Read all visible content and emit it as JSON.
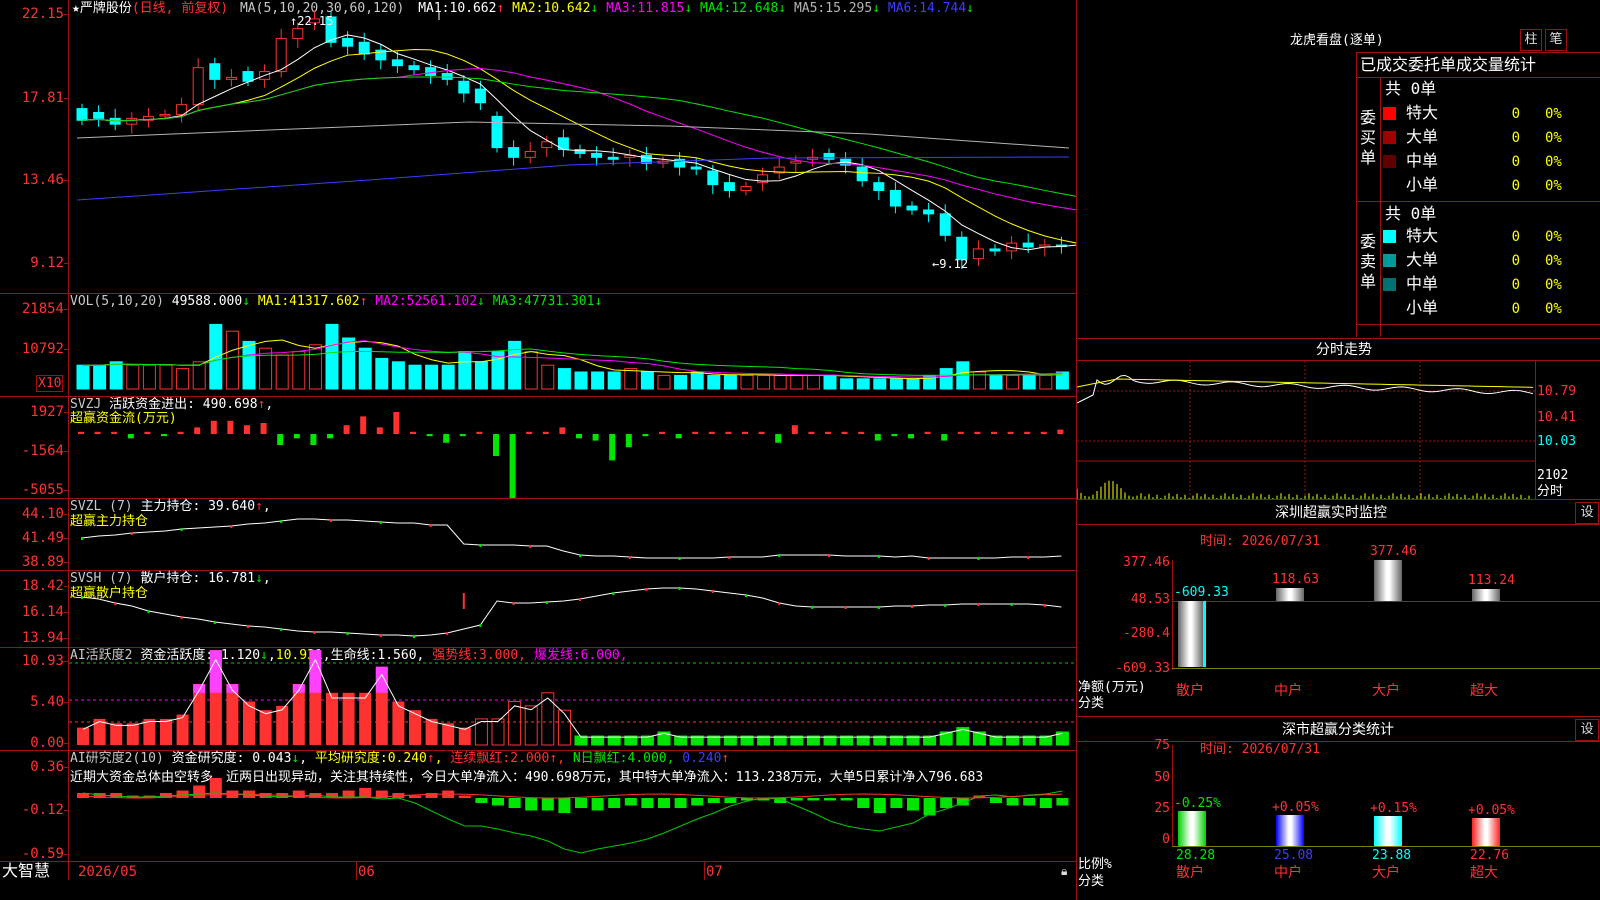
{
  "colors": {
    "up": "#ff3232",
    "down": "#00ffff",
    "ma1": "#ffffff",
    "ma2": "#ffff00",
    "ma3": "#ff00ff",
    "ma4": "#00e600",
    "ma5": "#b4b4b4",
    "ma6": "#3c3cff",
    "border": "#a01010"
  },
  "main": {
    "star": "★",
    "name": "严牌股份",
    "mode": "(日线, 前复权)",
    "ma_label": "MA(5,10,20,30,60,120)",
    "ma": [
      {
        "label": "MA1:",
        "value": "10.662",
        "arrow": "↑",
        "color": "#ffffff"
      },
      {
        "label": "MA2:",
        "value": "10.642",
        "arrow": "↓",
        "color": "#ffff00"
      },
      {
        "label": "MA3:",
        "value": "11.815",
        "arrow": "↓",
        "color": "#ff00ff"
      },
      {
        "label": "MA4:",
        "value": "12.648",
        "arrow": "↓",
        "color": "#00e600"
      },
      {
        "label": "MA5:",
        "value": "15.295",
        "arrow": "↓",
        "color": "#b4b4b4"
      },
      {
        "label": "MA6:",
        "value": "14.744",
        "arrow": "↓",
        "color": "#3c3cff"
      }
    ],
    "y_ticks": [
      "22.15",
      "17.81",
      "13.46",
      "9.12"
    ],
    "high_note": "22.15",
    "low_note": "9.12",
    "x_labels": [
      "2026/05",
      "06",
      "07"
    ]
  },
  "vol": {
    "label": "VOL(5,10,20)",
    "value": "49588.000",
    "arrow": "↓",
    "ma": [
      {
        "label": "MA1:",
        "value": "41317.602",
        "arrow": "↑",
        "color": "#ffff00"
      },
      {
        "label": "MA2:",
        "value": "52561.102",
        "arrow": "↓",
        "color": "#ff00ff"
      },
      {
        "label": "MA3:",
        "value": "47731.301",
        "arrow": "↓",
        "color": "#00e600"
      }
    ],
    "y_ticks": [
      "21854",
      "10792"
    ],
    "unit": "X10"
  },
  "svzj": {
    "label": "SVZJ",
    "title": "活跃资金进出:",
    "value": "490.698",
    "arrow": "↑",
    "comma": ",",
    "sub": "超赢资金流(万元)",
    "y_ticks": [
      "1927",
      "-1564",
      "-5055"
    ]
  },
  "svzl": {
    "label": "SVZL (7)",
    "title": "主力持仓:",
    "value": "39.640",
    "arrow": "↑",
    "comma": ",",
    "sub": "超赢主力持仓",
    "y_ticks": [
      "44.10",
      "41.49",
      "38.89"
    ]
  },
  "svsh": {
    "label": "SVSH (7)",
    "title": "散户持仓:",
    "value": "16.781",
    "arrow": "↓",
    "comma": ",",
    "sub": "超赢散户持仓",
    "y_ticks": [
      "18.42",
      "16.14",
      "13.94"
    ]
  },
  "ai1": {
    "label": "AI活跃度2",
    "t1": "资金活跃度:",
    "v1": "1.120",
    "a1": "↓",
    "c1": ",",
    "v2": "10.931",
    "c2": ",",
    "t3": "生命线:",
    "v3": "1.560",
    "c3": ",",
    "t4": "强势线:",
    "v4": "3.000",
    "c4": ",",
    "t5": "爆发线:",
    "v5": "6.000",
    "c5": ",",
    "y_ticks": [
      "10.93",
      "5.40",
      "0.00"
    ]
  },
  "ai2": {
    "label": "AI研究度2(10)",
    "t1": "资金研究度:",
    "v1": "0.043",
    "a1": "↓",
    "c1": ",",
    "t2": "平均研究度:",
    "v2": "0.240",
    "a2": "↑",
    "c2": ",",
    "t3": "连续飘红:",
    "v3": "2.000",
    "a3": "↑",
    "c3": ",",
    "t4": "N日飘红:",
    "v4": "4.000",
    "c4": ",",
    "v5": "0.240",
    "a5": "↑",
    "comment": "近期大资金总体由空转多，近两日出现异动，关注其持续性，今日大单净流入：490.698万元，其中特大单净流入：113.238万元，大单5日累计净入796.683",
    "y_ticks": [
      "0.36",
      "-0.12",
      "-0.59"
    ]
  },
  "footer": {
    "brand": "大智慧"
  },
  "lhb": {
    "title": "龙虎看盘(逐单)",
    "btn1": "柱",
    "btn2": "笔",
    "tabs": "已成交委托单成交量统计",
    "buy": {
      "side": "委买单",
      "total": "共 0单",
      "rows": [
        {
          "name": "特大",
          "val": "0",
          "pct": "0%",
          "color": "#ff0000"
        },
        {
          "name": "大单",
          "val": "0",
          "pct": "0%",
          "color": "#a00000"
        },
        {
          "name": "中单",
          "val": "0",
          "pct": "0%",
          "color": "#600000"
        },
        {
          "name": "小单",
          "val": "0",
          "pct": "0%",
          "color": "#000000"
        }
      ]
    },
    "sell": {
      "side": "委卖单",
      "total": "共 0单",
      "rows": [
        {
          "name": "特大",
          "val": "0",
          "pct": "0%",
          "color": "#00ffff"
        },
        {
          "name": "大单",
          "val": "0",
          "pct": "0%",
          "color": "#009a9a"
        },
        {
          "name": "中单",
          "val": "0",
          "pct": "0%",
          "color": "#007070"
        },
        {
          "name": "小单",
          "val": "0",
          "pct": "0%",
          "color": "#000000"
        }
      ]
    }
  },
  "fenshi": {
    "title": "分时走势",
    "y_ticks": [
      "10.79",
      "10.41",
      "10.03"
    ],
    "vol_tick": "2102",
    "unit": "分时"
  },
  "szmon": {
    "title": "深圳超赢实时监控",
    "btn": "设",
    "time": "时间: 2026/07/31",
    "y_ticks": [
      "377.46",
      "48.53",
      "-280.4",
      "-609.33"
    ],
    "left1": "净额(万元)",
    "left2": "分类",
    "bars": [
      {
        "cat": "散户",
        "value": "-609.33"
      },
      {
        "cat": "中户",
        "value": "118.63"
      },
      {
        "cat": "大户",
        "value": "377.46"
      },
      {
        "cat": "超大",
        "value": "113.24"
      }
    ]
  },
  "szcls": {
    "title": "深市超赢分类统计",
    "btn": "设",
    "time": "时间: 2026/07/31",
    "y_ticks": [
      "75",
      "50",
      "25",
      "0"
    ],
    "left1": "比例%",
    "left2": "分类",
    "bars": [
      {
        "cat": "散户",
        "value": "28.28",
        "chg": "-0.25%"
      },
      {
        "cat": "中户",
        "value": "25.08",
        "chg": "+0.05%"
      },
      {
        "cat": "大户",
        "value": "23.88",
        "chg": "+0.15%"
      },
      {
        "cat": "超大",
        "value": "22.76",
        "chg": "+0.05%"
      }
    ]
  }
}
